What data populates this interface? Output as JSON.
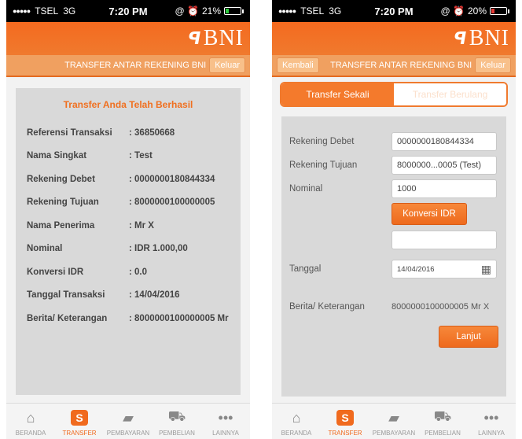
{
  "colors": {
    "accent": "#f06a1e",
    "brand_bar": "#f46a1f",
    "card": "#d9d9d9"
  },
  "left": {
    "status": {
      "carrier": "TSEL",
      "network": "3G",
      "time": "7:20 PM",
      "icons": "@ ⏰",
      "battery_pct": "21%",
      "battery_level": 0.21,
      "battery_color": "#2ecc40"
    },
    "brand": {
      "mark": "𝕊𝕊",
      "name": "BNI"
    },
    "title_bar": {
      "title": "TRANSFER ANTAR REKENING BNI",
      "logout": "Keluar"
    },
    "result": {
      "title": "Transfer Anda Telah Berhasil",
      "rows": [
        {
          "label": "Referensi Transaksi",
          "value": ": 36850668"
        },
        {
          "label": "Nama Singkat",
          "value": ": Test"
        },
        {
          "label": "Rekening Debet",
          "value": ": 0000000180844334"
        },
        {
          "label": "Rekening Tujuan",
          "value": ": 8000000100000005"
        },
        {
          "label": "Nama Penerima",
          "value": ": Mr X"
        },
        {
          "label": "Nominal",
          "value": ": IDR 1.000,00"
        },
        {
          "label": "Konversi IDR",
          "value": ": 0.0"
        },
        {
          "label": "Tanggal Transaksi",
          "value": ": 14/04/2016"
        },
        {
          "label": "Berita/ Keterangan",
          "value": ": 8000000100000005 Mr X"
        }
      ]
    }
  },
  "right": {
    "status": {
      "carrier": "TSEL",
      "network": "3G",
      "time": "7:20 PM",
      "icons": "@ ⏰",
      "battery_pct": "20%",
      "battery_level": 0.2,
      "battery_color": "#e53935"
    },
    "brand": {
      "mark": "𝕊𝕊",
      "name": "BNI"
    },
    "title_bar": {
      "back": "Kembali",
      "title": "TRANSFER ANTAR REKENING BNI",
      "logout": "Keluar"
    },
    "tabs": {
      "once": "Transfer Sekali",
      "recurring": "Transfer Berulang"
    },
    "form": {
      "debit_label": "Rekening Debet",
      "debit_value": "0000000180844334",
      "target_label": "Rekening Tujuan",
      "target_value": "8000000...0005 (Test)",
      "amount_label": "Nominal",
      "amount_value": "1000",
      "convert_button": "Konversi IDR",
      "convert_value": "",
      "date_label": "Tanggal",
      "date_value": "14/04/2016",
      "note_label": "Berita/ Keterangan",
      "note_value": "8000000100000005 Mr X",
      "next_button": "Lanjut"
    }
  },
  "nav": [
    {
      "label": "BERANDA",
      "icon": "home-icon"
    },
    {
      "label": "TRANSFER",
      "icon": "transfer-icon"
    },
    {
      "label": "PEMBAYARAN",
      "icon": "payment-card-icon"
    },
    {
      "label": "PEMBELIAN",
      "icon": "shopping-cart-icon"
    },
    {
      "label": "LAINNYA",
      "icon": "more-dots-icon"
    }
  ]
}
